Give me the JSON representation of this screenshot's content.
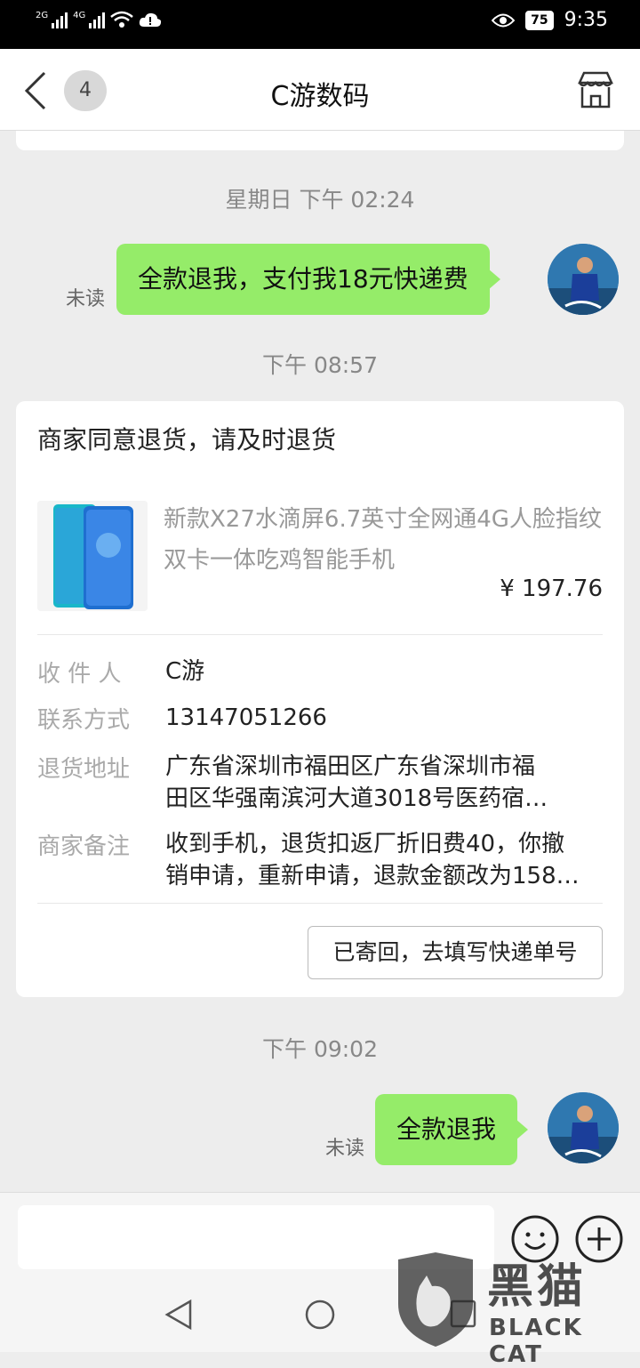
{
  "status_bar": {
    "sim1": "2G",
    "sim2": "4G",
    "battery": "75",
    "time": "9:35"
  },
  "header": {
    "back_count": "4",
    "title": "C游数码"
  },
  "messages": {
    "time1": "星期日 下午 02:24",
    "msg1": "全款退我，支付我18元快递费",
    "msg1_status": "未读",
    "time2": "下午 08:57",
    "time3": "下午 09:02",
    "msg2": "全款退我",
    "msg2_status": "未读"
  },
  "card": {
    "title": "商家同意退货，请及时退货",
    "product_name": "新款X27水滴屏6.7英寸全网通4G人脸指纹双卡一体吃鸡智能手机",
    "price": "¥ 197.76",
    "recipient_label": "收 件 人",
    "recipient": "C游",
    "contact_label": "联系方式",
    "contact": "13147051266",
    "address_label": "退货地址",
    "address_line1": "广东省深圳市福田区广东省深圳市福",
    "address_line2": "田区华强南滨河大道3018号医药宿…",
    "note_label": "商家备注",
    "note_line1": "收到手机，退货扣返厂折旧费40，你撤",
    "note_line2": "销申请，重新申请，退款金额改为158…",
    "action": "已寄回，去填写快递单号"
  },
  "watermark": {
    "cn": "黑猫",
    "en": "BLACK CAT"
  },
  "icons": [
    "back-icon",
    "shop-icon",
    "emoji-icon",
    "plus-icon",
    "nav-back-icon",
    "nav-home-icon",
    "nav-recent-icon"
  ],
  "colors": {
    "bubble": "#95ec69",
    "background": "#ededed"
  }
}
